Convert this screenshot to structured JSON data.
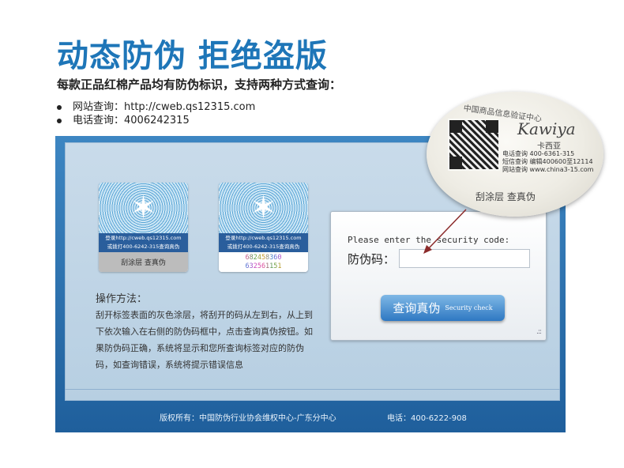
{
  "header": {
    "headline": "动态防伪 拒绝盗版",
    "subline": "每款正品红棉产品均有防伪标识，支持两种方式查询：",
    "bullets": [
      "网站查询：http://cweb.qs12315.com",
      "电话查询：4006242315"
    ]
  },
  "stickers": [
    {
      "band_line1": "登录http://cweb.qs12315.com",
      "band_line2": "或拨打400-6242-315查询真伪",
      "foot": "刮涂层 查真伪"
    },
    {
      "band_line1": "登录http://cweb.qs12315.com",
      "band_line2": "或拨打400-6242-315查询真伪",
      "code_line1": "682458360",
      "code_line2": "632561151"
    }
  ],
  "method": {
    "title": "操作方法：",
    "body": "刮开标签表面的灰色涂层，将刮开的码从左到右，从上到下依次输入在右侧的防伪码框中，点击查询真伪按钮。如果防伪码正确，系统将显示和您所查询标签对应的防伪码，如查询错误，系统将提示错误信息"
  },
  "query": {
    "prompt": "Please enter the security code:",
    "label": "防伪码：",
    "input_value": "",
    "button_cn": "查询真伪",
    "button_en": "Security check",
    "grip": ".::"
  },
  "footer": {
    "copyright": "版权所有：中国防伪行业协会维权中心-广东分中心",
    "phone": "电话：400-6222-908"
  },
  "seal": {
    "title": "中国商品信息验证中心",
    "signature": "Kawiya",
    "signature_cn": "卡西亚",
    "line1": "电话查询 400-6361-315",
    "line2": "短信查询 编辑400600至12114",
    "line3": "网站查询 www.china3-15.com",
    "scratch": "刮涂层 查真伪"
  },
  "colors": {
    "headline": "#1e76b8",
    "frame": "#2b6eae",
    "button": "#3c86cf",
    "arrow": "#8b2a2a"
  }
}
